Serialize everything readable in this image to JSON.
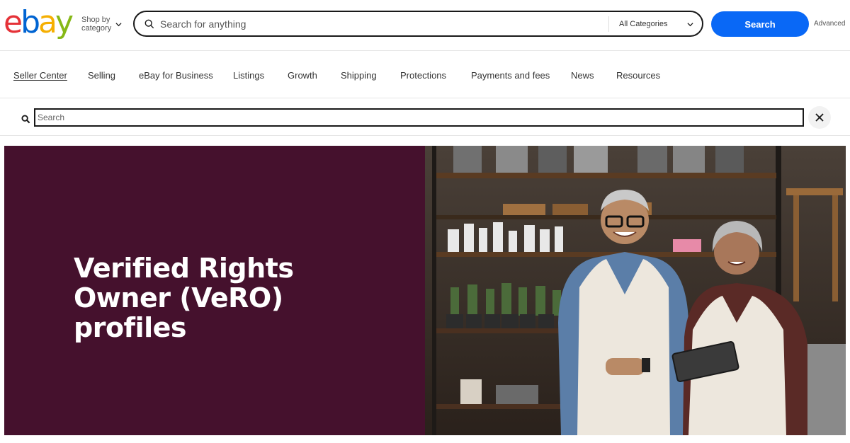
{
  "header": {
    "logo_letters": [
      "e",
      "b",
      "a",
      "y"
    ],
    "logo_colors": [
      "#e53238",
      "#0064d2",
      "#f5af02",
      "#86b817"
    ],
    "shop_by_line1": "Shop by",
    "shop_by_line2": "category",
    "search_placeholder": "Search for anything",
    "category_selected": "All Categories",
    "search_button": "Search",
    "advanced_link": "Advanced"
  },
  "seller_nav": {
    "items": [
      {
        "label": "Seller Center",
        "active": true
      },
      {
        "label": "Selling"
      },
      {
        "label": "eBay for Business"
      },
      {
        "label": "Listings"
      },
      {
        "label": "Growth"
      },
      {
        "label": "Shipping"
      },
      {
        "label": "Protections"
      },
      {
        "label": "Payments and fees"
      },
      {
        "label": "News"
      },
      {
        "label": "Resources"
      }
    ]
  },
  "sub_search": {
    "placeholder": "Search"
  },
  "hero": {
    "title": "Verified Rights Owner (VeRO) profiles",
    "background_color": "#45112d"
  },
  "colors": {
    "search_button": "#0968f6",
    "text": "#191919"
  },
  "icons": [
    "search-icon",
    "chevron-down-icon",
    "magnifier-icon",
    "close-icon"
  ]
}
